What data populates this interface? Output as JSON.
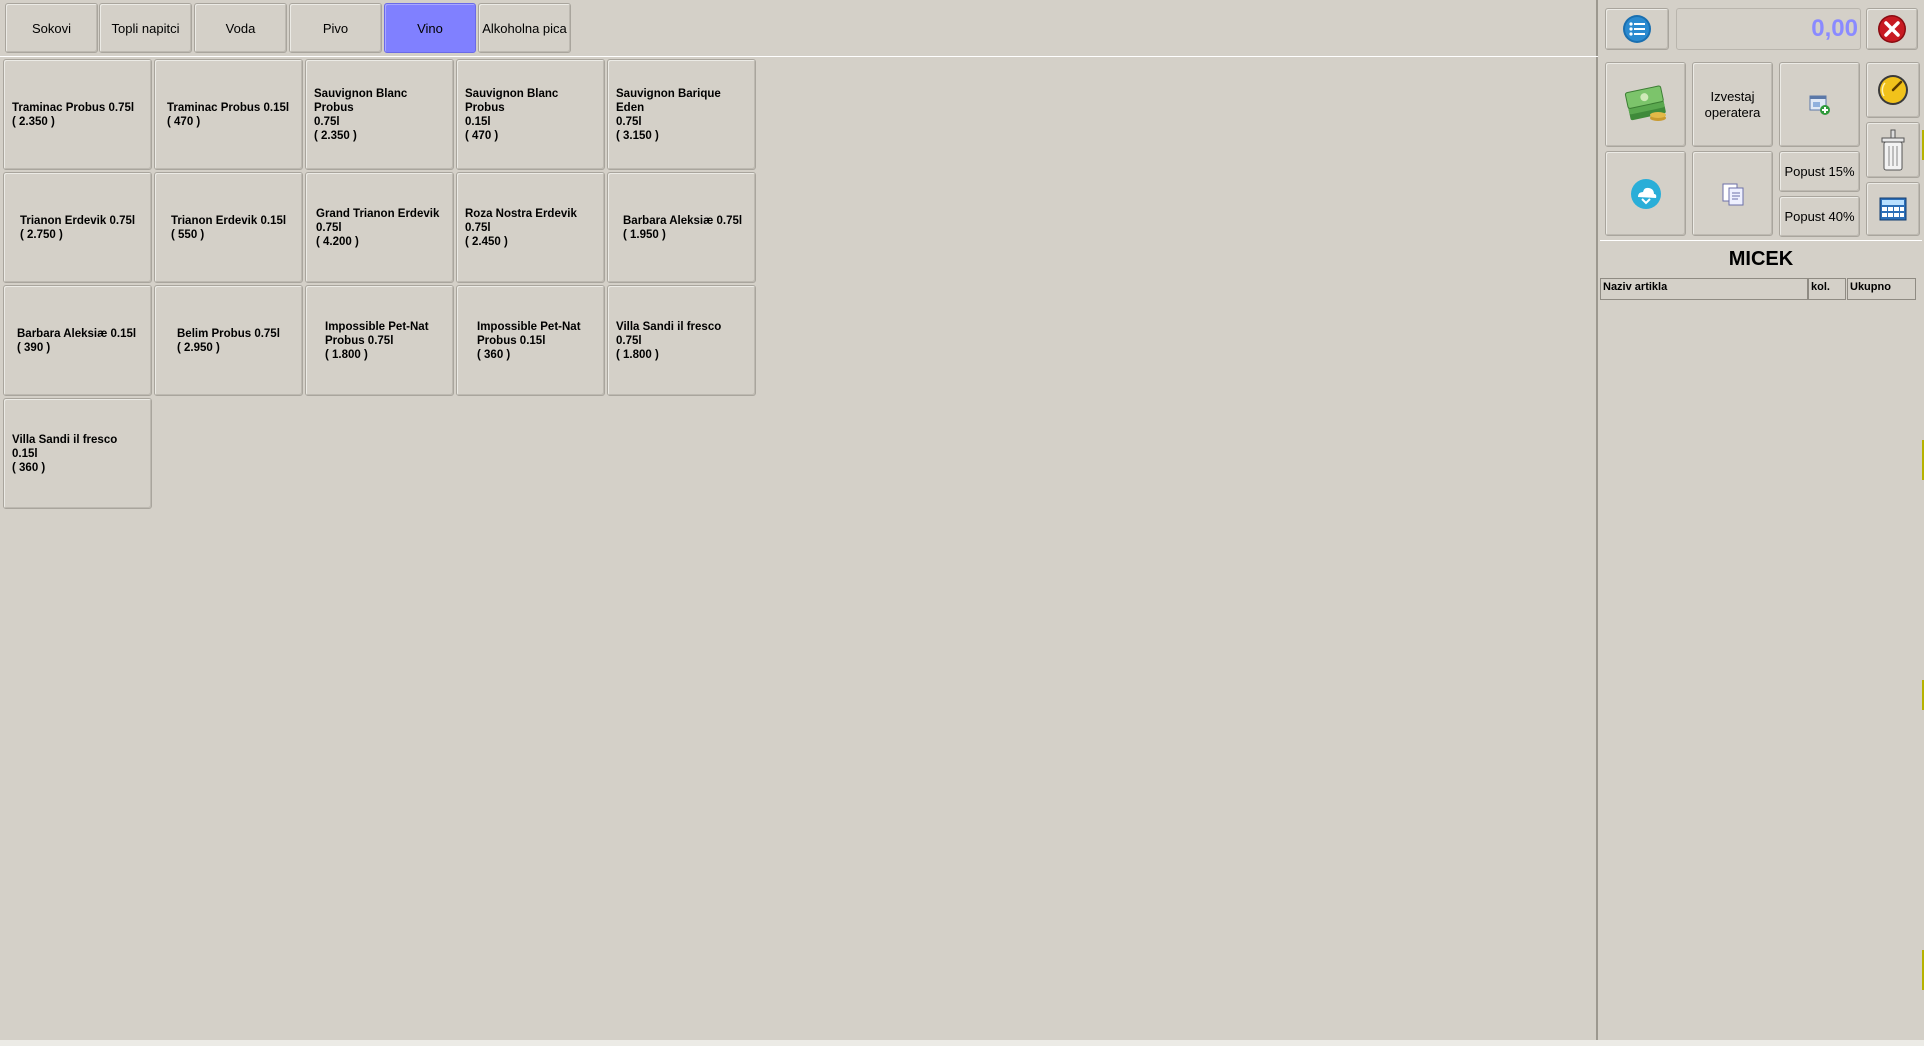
{
  "tabs": [
    {
      "label": "Sokovi",
      "active": false
    },
    {
      "label": "Topli napitci",
      "active": false
    },
    {
      "label": "Voda",
      "active": false
    },
    {
      "label": "Pivo",
      "active": false
    },
    {
      "label": "Vino",
      "active": true
    },
    {
      "label": "Alkoholna pica",
      "active": false
    }
  ],
  "products": [
    {
      "name": "Traminac Probus 0.75l\n( 2.350 )"
    },
    {
      "name": "Traminac Probus 0.15l\n( 470 )"
    },
    {
      "name": "Sauvignon Blanc Probus\n0.75l\n( 2.350 )"
    },
    {
      "name": "Sauvignon Blanc Probus\n0.15l\n( 470 )"
    },
    {
      "name": "Sauvignon Barique Eden\n0.75l\n( 3.150 )"
    },
    {
      "name": "Trianon Erdevik 0.75l\n( 2.750 )"
    },
    {
      "name": "Trianon Erdevik 0.15l\n( 550 )"
    },
    {
      "name": "Grand Trianon Erdevik\n0.75l\n( 4.200 )"
    },
    {
      "name": "Roza Nostra Erdevik 0.75l\n( 2.450 )"
    },
    {
      "name": "Barbara Aleksiæ 0.75l\n( 1.950 )"
    },
    {
      "name": "Barbara Aleksiæ 0.15l\n( 390 )"
    },
    {
      "name": "Belim Probus 0.75l\n( 2.950 )"
    },
    {
      "name": "Impossible Pet-Nat\nProbus 0.75l\n( 1.800 )"
    },
    {
      "name": "Impossible Pet-Nat\nProbus 0.15l\n( 360 )"
    },
    {
      "name": "Villa Sandi il fresco 0.75l\n( 1.800 )"
    },
    {
      "name": "Villa Sandi il fresco 0.15l\n( 360 )"
    }
  ],
  "right_panel": {
    "total": "0,00",
    "operator_report_label": "Izvestaj\noperatera",
    "discount_15_label": "Popust 15%",
    "discount_40_label": "Popust 40%",
    "waiter_name": "MICEK",
    "columns": {
      "name": "Naziv artikla",
      "qty": "kol.",
      "total": "Ukupno"
    }
  },
  "icons": {
    "menu": "list-menu-icon",
    "close": "close-icon",
    "cash": "money-stack-icon",
    "add_table": "add-window-icon",
    "gauge": "gauge-icon",
    "bin": "waste-bin-icon",
    "cloud": "cloud-icon",
    "copy": "copy-documents-icon",
    "calculator": "calculator-icon"
  },
  "colors": {
    "background": "#d4d0c8",
    "active_tab": "#8080ff",
    "total_text": "#8a8aff",
    "close_red": "#c0101a"
  }
}
